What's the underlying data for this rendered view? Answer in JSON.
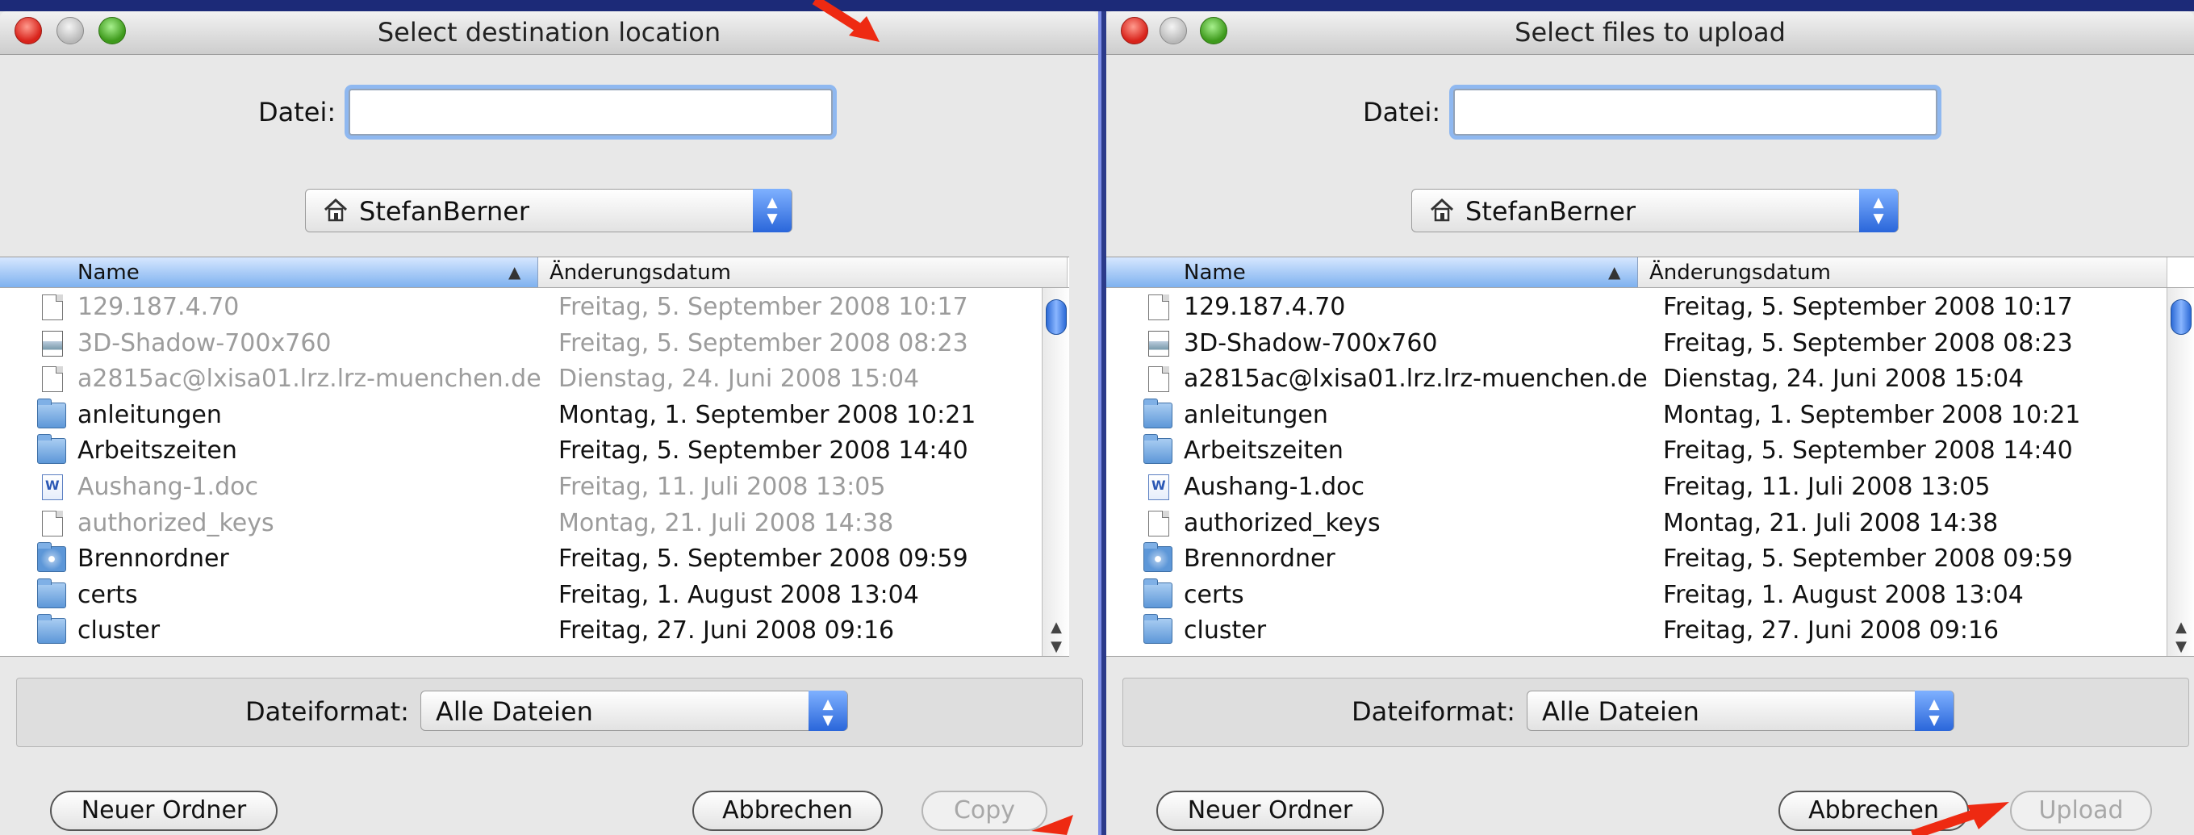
{
  "left_window": {
    "title": "Select destination location",
    "file_label": "Datei:",
    "file_value": "",
    "location": "StefanBerner",
    "columns": {
      "name": "Name",
      "date": "Änderungsdatum"
    },
    "format_label": "Dateiformat:",
    "format_value": "Alle Dateien",
    "new_folder_label": "Neuer Ordner",
    "cancel_label": "Abbrechen",
    "confirm_label": "Copy"
  },
  "right_window": {
    "title": "Select files to upload",
    "file_label": "Datei:",
    "file_value": "",
    "location": "StefanBerner",
    "columns": {
      "name": "Name",
      "date": "Änderungsdatum"
    },
    "format_label": "Dateiformat:",
    "format_value": "Alle Dateien",
    "new_folder_label": "Neuer Ordner",
    "cancel_label": "Abbrechen",
    "confirm_label": "Upload"
  },
  "files": [
    {
      "name": "129.187.4.70",
      "date": "Freitag, 5. September 2008 10:17",
      "icon": "file-icon",
      "disabled_in_left": true
    },
    {
      "name": "3D-Shadow-700x760",
      "date": "Freitag, 5. September 2008 08:23",
      "icon": "image-file-icon",
      "disabled_in_left": true
    },
    {
      "name": "a2815ac@lxisa01.lrz.lrz-muenchen.de",
      "date": "Dienstag, 24. Juni 2008 15:04",
      "icon": "document-icon",
      "disabled_in_left": true
    },
    {
      "name": "anleitungen",
      "date": "Montag, 1. September 2008 10:21",
      "icon": "folder-icon",
      "disabled_in_left": false
    },
    {
      "name": "Arbeitszeiten",
      "date": "Freitag, 5. September 2008 14:40",
      "icon": "folder-icon",
      "disabled_in_left": false
    },
    {
      "name": "Aushang-1.doc",
      "date": "Freitag, 11. Juli 2008 13:05",
      "icon": "word-document-icon",
      "disabled_in_left": true
    },
    {
      "name": "authorized_keys",
      "date": "Montag, 21. Juli 2008 14:38",
      "icon": "document-icon",
      "disabled_in_left": true
    },
    {
      "name": "Brennordner",
      "date": "Freitag, 5. September 2008 09:59",
      "icon": "burn-folder-icon",
      "disabled_in_left": false
    },
    {
      "name": "certs",
      "date": "Freitag, 1. August 2008 13:04",
      "icon": "folder-icon",
      "disabled_in_left": false
    },
    {
      "name": "cluster",
      "date": "Freitag, 27. Juni 2008 09:16",
      "icon": "folder-icon",
      "disabled_in_left": false
    }
  ]
}
